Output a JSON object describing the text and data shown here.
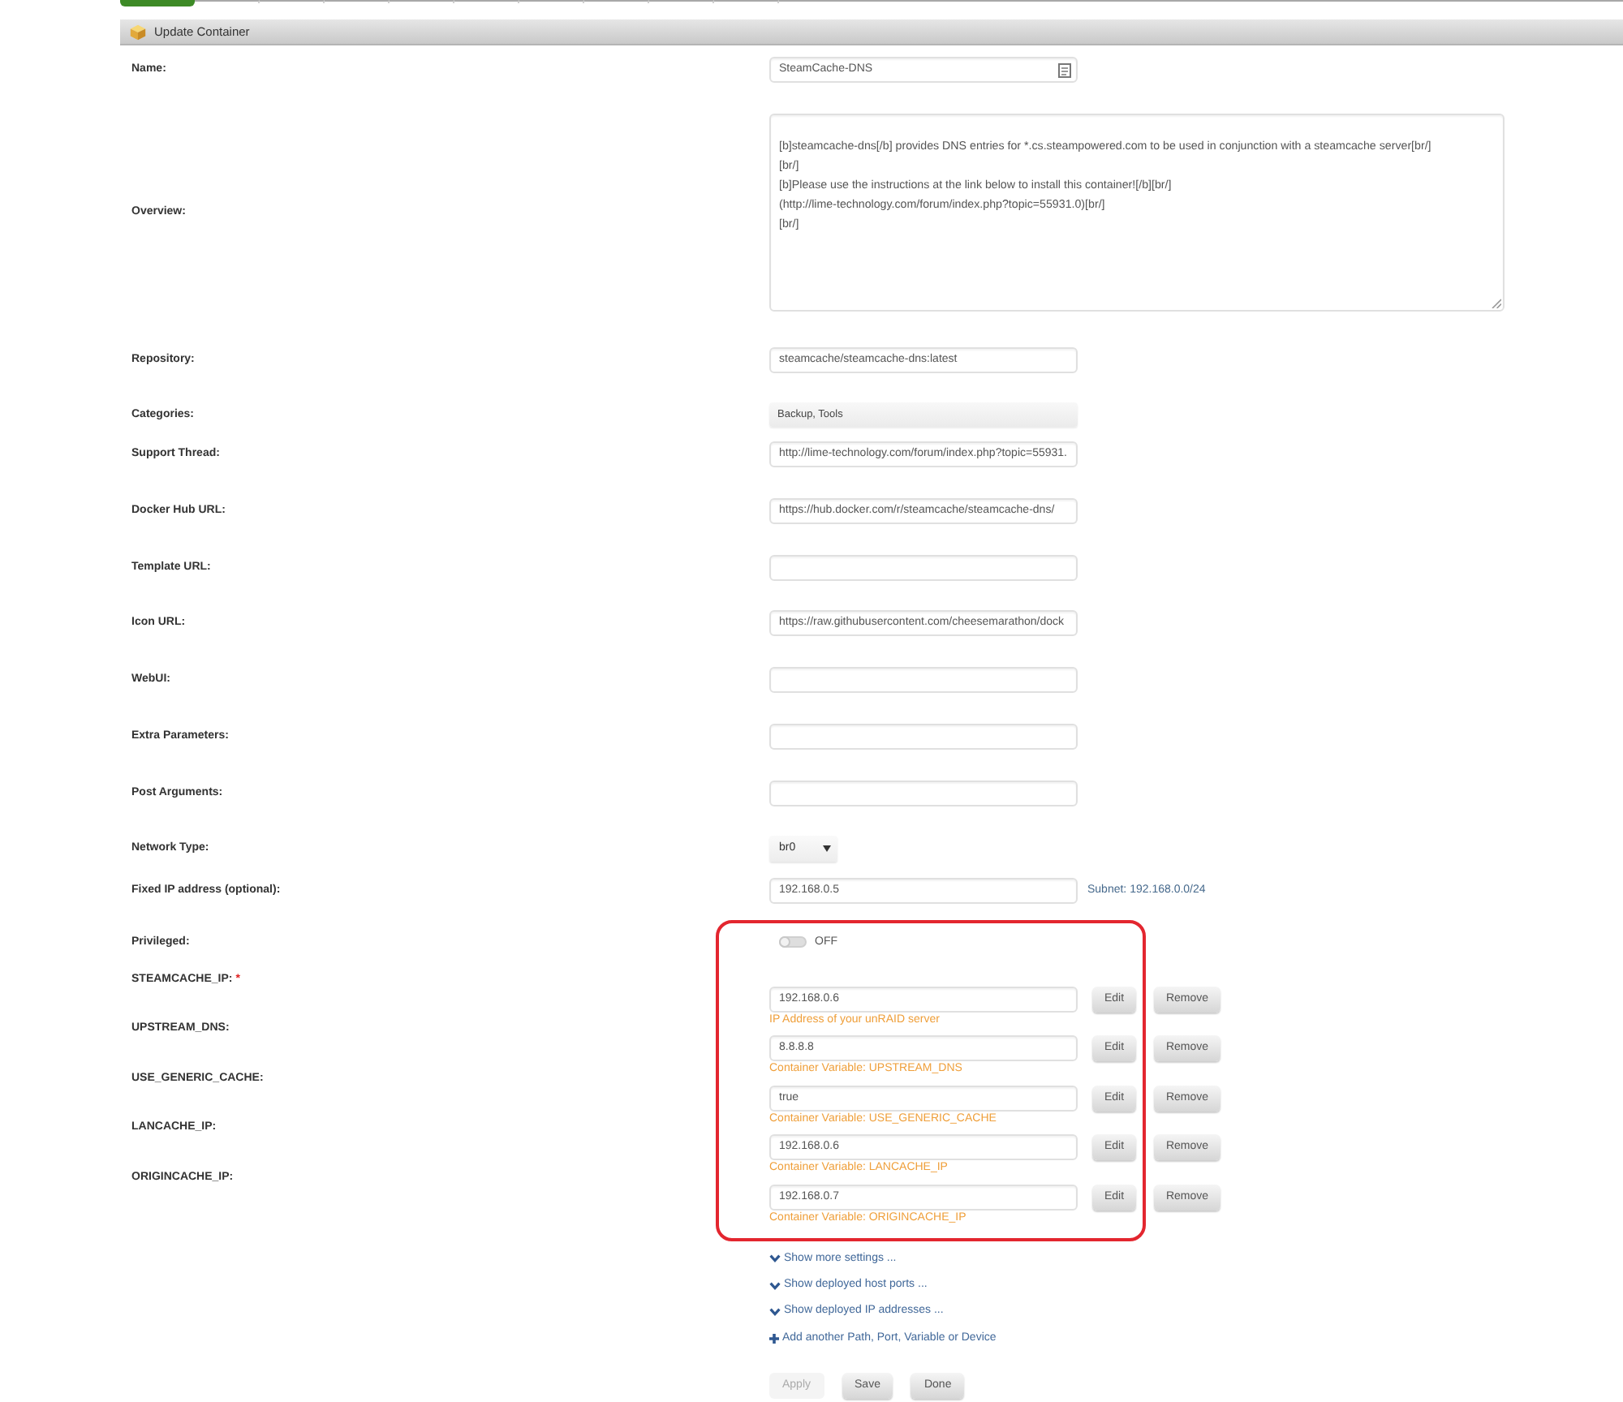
{
  "tabs": [
    {
      "selected": true
    },
    {
      "selected": false
    },
    {
      "selected": false
    },
    {
      "selected": false
    },
    {
      "selected": false
    },
    {
      "selected": false
    },
    {
      "selected": false
    },
    {
      "selected": false
    },
    {
      "selected": false
    },
    {
      "selected": false
    }
  ],
  "panel": {
    "title": "Update Container"
  },
  "fields": [
    {
      "kind": "text",
      "label": "Name:",
      "value": "SteamCache-DNS"
    },
    {
      "kind": "textarea",
      "label": "Overview:",
      "lines": [
        "[b]steamcache-dns[/b] provides DNS entries for *.cs.steampowered.com to be used in conjunction with a steamcache server[br/]",
        "[br/]",
        "[b]Please use the instructions at the link below to install this container![/b][br/]",
        "(http://lime-technology.com/forum/index.php?topic=55931.0)[br/]",
        "[br/]"
      ]
    },
    {
      "kind": "text",
      "label": "Repository:",
      "value": "steamcache/steamcache-dns:latest"
    },
    {
      "kind": "multiselect",
      "label": "Categories:",
      "value": "Backup, Tools"
    },
    {
      "kind": "text",
      "label": "Support Thread:",
      "value": "http://lime-technology.com/forum/index.php?topic=55931."
    },
    {
      "kind": "text",
      "label": "Docker Hub URL:",
      "value": "https://hub.docker.com/r/steamcache/steamcache-dns/"
    },
    {
      "kind": "text",
      "label": "Template URL:"
    },
    {
      "kind": "text",
      "label": "Icon URL:",
      "value": "https://raw.githubusercontent.com/cheesemarathon/dock"
    },
    {
      "kind": "text",
      "label": "WebUI:"
    },
    {
      "kind": "text",
      "label": "Extra Parameters:"
    },
    {
      "kind": "text",
      "label": "Post Arguments:"
    },
    {
      "kind": "select",
      "label": "Network Type:",
      "value": "br0"
    },
    {
      "kind": "text",
      "label": "Fixed IP address (optional):",
      "value": "192.168.0.5",
      "note": "Subnet: 192.168.0.0/24"
    },
    {
      "kind": "toggle",
      "label": "Privileged:",
      "on": false,
      "state_text": "OFF"
    }
  ],
  "variables": [
    {
      "label": "STEAMCACHE_IP:",
      "required_mark": "*",
      "value": "192.168.0.6",
      "description": "IP Address of your unRAID server",
      "edit": "Edit",
      "remove": "Remove"
    },
    {
      "label": "UPSTREAM_DNS:",
      "value": "8.8.8.8",
      "description": "Container Variable: UPSTREAM_DNS",
      "edit": "Edit",
      "remove": "Remove"
    },
    {
      "label": "USE_GENERIC_CACHE:",
      "value": "true",
      "description": "Container Variable: USE_GENERIC_CACHE",
      "edit": "Edit",
      "remove": "Remove"
    },
    {
      "label": "LANCACHE_IP:",
      "value": "192.168.0.6",
      "description": "Container Variable: LANCACHE_IP",
      "edit": "Edit",
      "remove": "Remove"
    },
    {
      "label": "ORIGINCACHE_IP:",
      "value": "192.168.0.7",
      "description": "Container Variable: ORIGINCACHE_IP",
      "edit": "Edit",
      "remove": "Remove"
    }
  ],
  "links": [
    {
      "kind": "expand",
      "text": "Show more settings ..."
    },
    {
      "kind": "expand",
      "text": "Show deployed host ports ..."
    },
    {
      "kind": "expand",
      "text": "Show deployed IP addresses ..."
    },
    {
      "kind": "add",
      "text": "Add another Path, Port, Variable or Device"
    }
  ],
  "buttons": [
    {
      "label": "Apply",
      "disabled": true
    },
    {
      "label": "Save",
      "disabled": false
    },
    {
      "label": "Done",
      "disabled": false
    }
  ]
}
